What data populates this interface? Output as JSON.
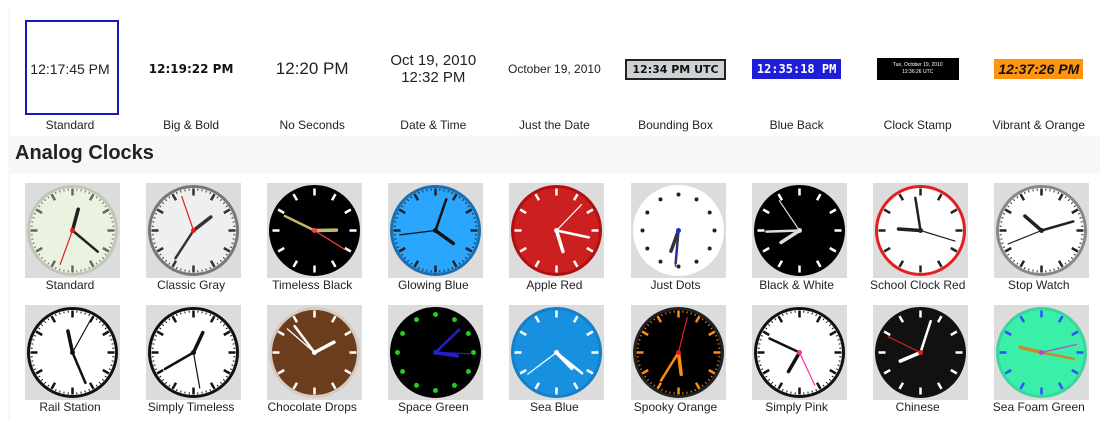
{
  "digital": [
    {
      "key": "standard",
      "lines": [
        "12:17:45 PM"
      ],
      "label": "Standard"
    },
    {
      "key": "bold",
      "lines": [
        "12:19:22 PM"
      ],
      "label": "Big & Bold"
    },
    {
      "key": "noseconds",
      "lines": [
        "12:20 PM"
      ],
      "label": "No Seconds"
    },
    {
      "key": "datetime",
      "lines": [
        "Oct 19, 2010",
        "12:32 PM"
      ],
      "label": "Date & Time"
    },
    {
      "key": "date",
      "lines": [
        "October 19, 2010"
      ],
      "label": "Just the Date"
    },
    {
      "key": "box",
      "lines": [
        "12:34 PM UTC"
      ],
      "label": "Bounding Box"
    },
    {
      "key": "blue",
      "lines": [
        "12:35:18 PM"
      ],
      "label": "Blue Back"
    },
    {
      "key": "stamp",
      "lines": [
        "Tue, October 19, 2010",
        "12:36:26 UTC"
      ],
      "label": "Clock Stamp"
    },
    {
      "key": "orange",
      "lines": [
        "12:37:26 PM"
      ],
      "label": "Vibrant & Orange"
    }
  ],
  "section_title": "Analog Clocks",
  "analog_row1": [
    {
      "label": "Standard",
      "face": "#e9f3df",
      "rim": "#bfc7bb",
      "hands": "#222",
      "sec": "#e02020",
      "marks": "#666"
    },
    {
      "label": "Classic Gray",
      "face": "#efefef",
      "rim": "#777",
      "hands": "#333",
      "sec": "#e02020",
      "marks": "#333"
    },
    {
      "label": "Timeless Black",
      "face": "#000",
      "rim": "#000",
      "hands": "#c8b46a",
      "sec": "#ff4040",
      "marks": "#fff"
    },
    {
      "label": "Glowing Blue",
      "face": "#2aa6ff",
      "rim": "#1a6fb0",
      "hands": "#111",
      "sec": "#111",
      "marks": "#222"
    },
    {
      "label": "Apple Red",
      "face": "#cc1f1f",
      "rim": "#b01010",
      "hands": "#fff",
      "sec": "#fff",
      "marks": "#fff"
    },
    {
      "label": "Just Dots",
      "face": "#fff",
      "rim": "#fff",
      "hands": "#333",
      "sec": "#2030d0",
      "marks": "#222"
    },
    {
      "label": "Black & White",
      "face": "#000",
      "rim": "#000",
      "hands": "#ddd",
      "sec": "#ddd",
      "marks": "#fff"
    },
    {
      "label": "School Clock Red",
      "face": "#fff",
      "rim": "#e02020",
      "hands": "#222",
      "sec": "#222",
      "marks": "#222"
    },
    {
      "label": "Stop Watch",
      "face": "#fff",
      "rim": "#888",
      "hands": "#222",
      "sec": "#222",
      "marks": "#222"
    }
  ],
  "analog_row2": [
    {
      "label": "Rail Station",
      "face": "#fff",
      "rim": "#111",
      "hands": "#111",
      "sec": "#111",
      "marks": "#111"
    },
    {
      "label": "Simply Timeless",
      "face": "#fff",
      "rim": "#111",
      "hands": "#111",
      "sec": "#111",
      "marks": "#111"
    },
    {
      "label": "Chocolate Drops",
      "face": "#6b3d1c",
      "rim": "#d7cbc0",
      "hands": "#fff",
      "sec": "#fff",
      "marks": "#fff"
    },
    {
      "label": "Space Green",
      "face": "#000",
      "rim": "#000",
      "hands": "#2222cc",
      "sec": "#2222cc",
      "marks": "#22cc22"
    },
    {
      "label": "Sea Blue",
      "face": "#1890e0",
      "rim": "#1480c8",
      "hands": "#fff",
      "sec": "#fff",
      "marks": "#fff"
    },
    {
      "label": "Spooky Orange",
      "face": "#000",
      "rim": "#222",
      "hands": "#ff8c10",
      "sec": "#e02020",
      "marks": "#ff8c10"
    },
    {
      "label": "Simply Pink",
      "face": "#fff",
      "rim": "#111",
      "hands": "#111",
      "sec": "#ff2fa0",
      "marks": "#111"
    },
    {
      "label": "Chinese",
      "face": "#111",
      "rim": "#111",
      "hands": "#fff",
      "sec": "#e02020",
      "marks": "#fff"
    },
    {
      "label": "Sea Foam Green",
      "face": "#3af0a8",
      "rim": "#3ad6a0",
      "hands": "#c88a2a",
      "sec": "#c040c0",
      "marks": "#3050ff"
    }
  ],
  "ui": {
    "selected_index": 0
  }
}
